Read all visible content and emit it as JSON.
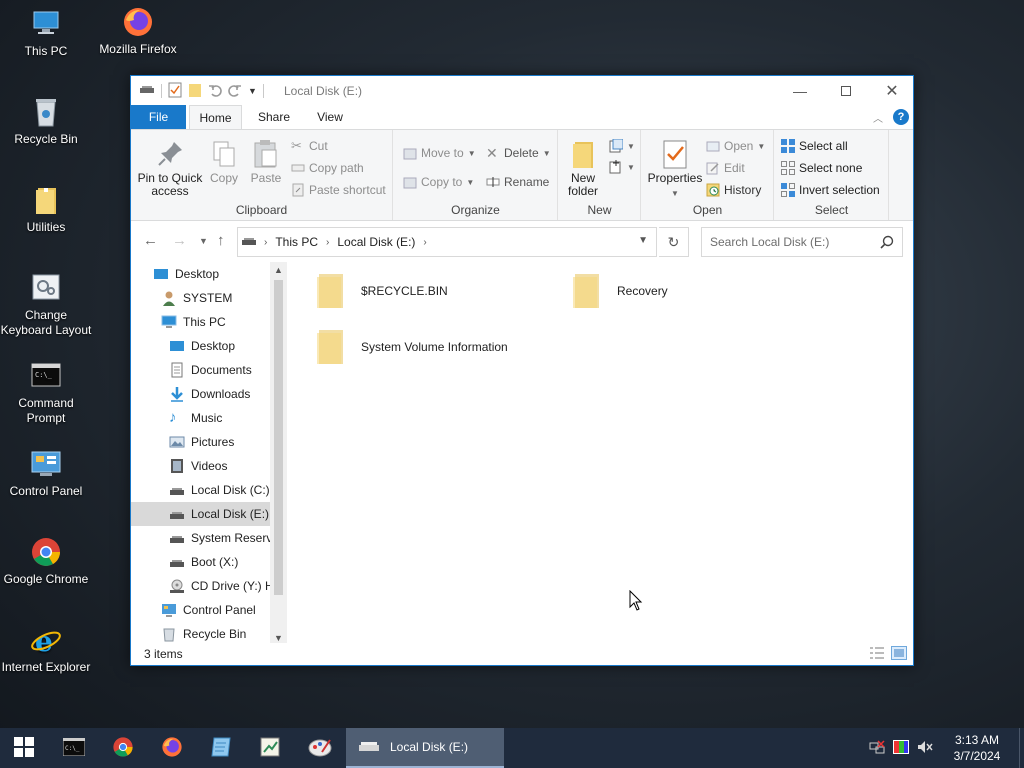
{
  "desktop": {
    "icons": [
      {
        "label": "This PC"
      },
      {
        "label": "Mozilla Firefox"
      },
      {
        "label": "Recycle Bin"
      },
      {
        "label": "Utilities"
      },
      {
        "label": "Change Keyboard Layout"
      },
      {
        "label": "Command Prompt"
      },
      {
        "label": "Control Panel"
      },
      {
        "label": "Google Chrome"
      },
      {
        "label": "Internet Explorer"
      }
    ]
  },
  "window": {
    "title": "Local Disk (E:)",
    "tabs": {
      "file": "File",
      "home": "Home",
      "share": "Share",
      "view": "View"
    },
    "help": "?",
    "ribbon": {
      "clipboard": {
        "label": "Clipboard",
        "pin": "Pin to Quick access",
        "copy": "Copy",
        "paste": "Paste",
        "cut": "Cut",
        "copy_path": "Copy path",
        "paste_shortcut": "Paste shortcut"
      },
      "organize": {
        "label": "Organize",
        "move_to": "Move to",
        "copy_to": "Copy to",
        "delete": "Delete",
        "rename": "Rename"
      },
      "new": {
        "label": "New",
        "new_folder": "New folder"
      },
      "open": {
        "label": "Open",
        "properties": "Properties",
        "open": "Open",
        "edit": "Edit",
        "history": "History"
      },
      "select": {
        "label": "Select",
        "select_all": "Select all",
        "select_none": "Select none",
        "invert": "Invert selection"
      }
    },
    "address": {
      "crumbs": [
        "This PC",
        "Local Disk (E:)"
      ],
      "search_placeholder": "Search Local Disk (E:)"
    },
    "nav": [
      {
        "label": "Desktop"
      },
      {
        "label": "SYSTEM"
      },
      {
        "label": "This PC"
      },
      {
        "label": "Desktop"
      },
      {
        "label": "Documents"
      },
      {
        "label": "Downloads"
      },
      {
        "label": "Music"
      },
      {
        "label": "Pictures"
      },
      {
        "label": "Videos"
      },
      {
        "label": "Local Disk (C:)"
      },
      {
        "label": "Local Disk (E:)"
      },
      {
        "label": "System Reserved"
      },
      {
        "label": "Boot (X:)"
      },
      {
        "label": "CD Drive (Y:) H"
      },
      {
        "label": "Control Panel"
      },
      {
        "label": "Recycle Bin"
      }
    ],
    "files": [
      {
        "name": "$RECYCLE.BIN"
      },
      {
        "name": "Recovery"
      },
      {
        "name": "System Volume Information"
      }
    ],
    "status": "3 items"
  },
  "taskbar": {
    "active_window": "Local Disk (E:)",
    "time": "3:13 AM",
    "date": "3/7/2024"
  }
}
